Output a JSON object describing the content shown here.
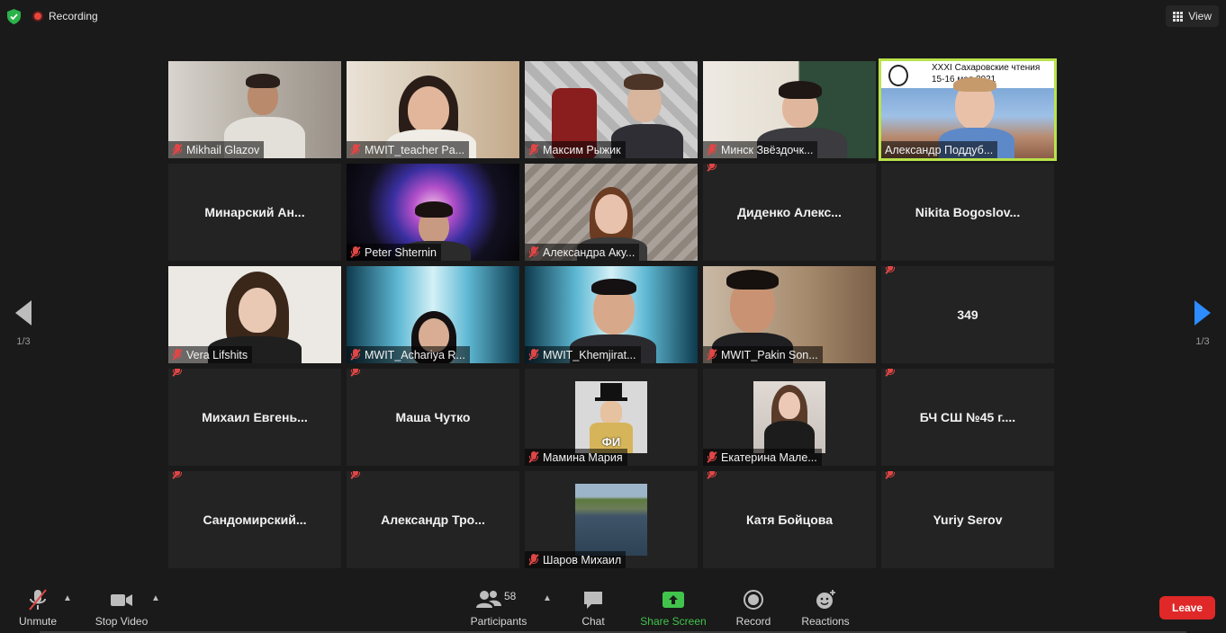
{
  "topbar": {
    "recording_label": "Recording",
    "view_label": "View"
  },
  "navigation": {
    "left_page": "1/3",
    "right_page": "1/3"
  },
  "tiles": [
    {
      "name": "Mikhail Glazov",
      "type": "video",
      "muted": true
    },
    {
      "name": "MWIT_teacher Pa...",
      "type": "video",
      "muted": true
    },
    {
      "name": "Максим Рыжик",
      "type": "video",
      "muted": true
    },
    {
      "name": "Минск Звёздочк...",
      "type": "video",
      "muted": true
    },
    {
      "name": "Александр Поддуб...",
      "type": "video",
      "muted": false,
      "active": true,
      "banner_line1": "XXXI Сахаровские чтения",
      "banner_line2": "15-16 мая 2021"
    },
    {
      "name": "Минарский Ан...",
      "type": "name"
    },
    {
      "name": "Peter Shternin",
      "type": "video",
      "muted": true
    },
    {
      "name": "Александра Аку...",
      "type": "video",
      "muted": true
    },
    {
      "name": "Диденко Алекс...",
      "type": "name",
      "muted": true
    },
    {
      "name": "Nikita Bogoslov...",
      "type": "name"
    },
    {
      "name": "Vera Lifshits",
      "type": "video",
      "muted": true
    },
    {
      "name": "MWIT_Achariya R...",
      "type": "video",
      "muted": true
    },
    {
      "name": "MWIT_Khemjirat...",
      "type": "video",
      "muted": true
    },
    {
      "name": "MWIT_Pakin Son...",
      "type": "video",
      "muted": true
    },
    {
      "name": "349",
      "type": "name",
      "muted": true
    },
    {
      "name": "Михаил Евгень...",
      "type": "name",
      "muted": true
    },
    {
      "name": "Маша Чутко",
      "type": "name",
      "muted": true
    },
    {
      "name": "Мамина Мария",
      "type": "avatar",
      "muted": true,
      "avatar_text": "ФИ"
    },
    {
      "name": "Екатерина Мале...",
      "type": "avatar",
      "muted": true
    },
    {
      "name": "БЧ СШ №45 г....",
      "type": "name",
      "muted": true
    },
    {
      "name": "Сандомирский...",
      "type": "name",
      "muted": true
    },
    {
      "name": "Александр Тро...",
      "type": "name",
      "muted": true
    },
    {
      "name": "Шаров Михаил",
      "type": "avatar",
      "muted": true
    },
    {
      "name": "Катя Бойцова",
      "type": "name",
      "muted": true
    },
    {
      "name": "Yuriy Serov",
      "type": "name",
      "muted": true
    }
  ],
  "toolbar": {
    "unmute_label": "Unmute",
    "stop_video_label": "Stop Video",
    "participants_label": "Participants",
    "participants_count": "58",
    "chat_label": "Chat",
    "share_screen_label": "Share Screen",
    "record_label": "Record",
    "reactions_label": "Reactions",
    "leave_label": "Leave"
  },
  "colors": {
    "background": "#1a1a1a",
    "tile": "#232323",
    "active_border": "#b9e34b",
    "share_green": "#41c44c",
    "leave_red": "#e02828",
    "nav_blue": "#2d8cff",
    "mute_red": "#e04646"
  }
}
